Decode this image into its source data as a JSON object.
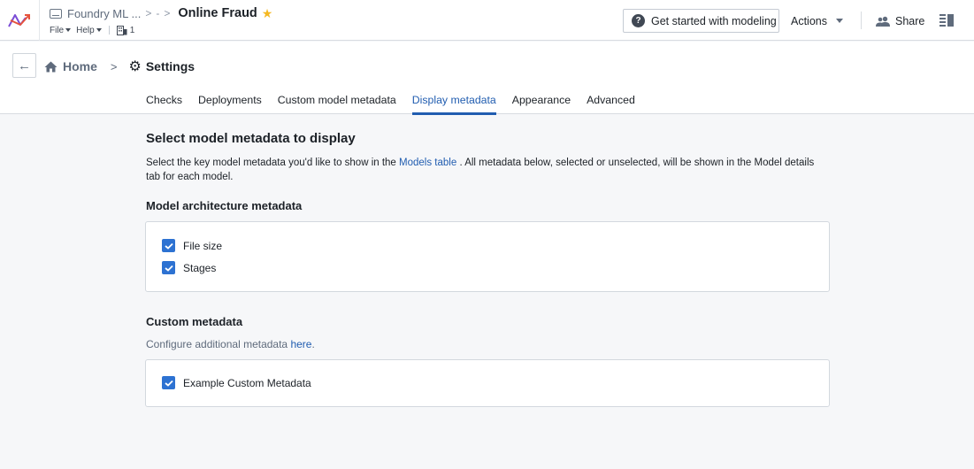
{
  "header": {
    "parent_folder": "Foundry ML ...",
    "dash": "-",
    "title": "Online Fraud",
    "menus": [
      {
        "label": "File"
      },
      {
        "label": "Help"
      }
    ],
    "branch_count": "1",
    "get_started_label": "Get started with modeling",
    "actions_label": "Actions",
    "share_label": "Share",
    "colors": {
      "star": "#f5b821",
      "accent": "#215db0"
    }
  },
  "nav": {
    "home_label": "Home",
    "settings_label": "Settings"
  },
  "tabs": [
    {
      "label": "Checks",
      "active": false
    },
    {
      "label": "Deployments",
      "active": false
    },
    {
      "label": "Custom model metadata",
      "active": false
    },
    {
      "label": "Display metadata",
      "active": true
    },
    {
      "label": "Appearance",
      "active": false
    },
    {
      "label": "Advanced",
      "active": false
    }
  ],
  "main": {
    "title": "Select model metadata to display",
    "description_before": "Select the key model metadata you'd like to show in the ",
    "description_link": "Models table",
    "description_after": " . All metadata below, selected or unselected, will be shown in the Model details tab for each model.",
    "architecture": {
      "heading": "Model architecture metadata",
      "items": [
        {
          "label": "File size",
          "checked": true
        },
        {
          "label": "Stages",
          "checked": true
        }
      ]
    },
    "custom": {
      "heading": "Custom metadata",
      "configure_text": "Configure additional metadata ",
      "configure_link": "here",
      "configure_suffix": ".",
      "items": [
        {
          "label": "Example Custom Metadata",
          "checked": true
        }
      ]
    }
  }
}
